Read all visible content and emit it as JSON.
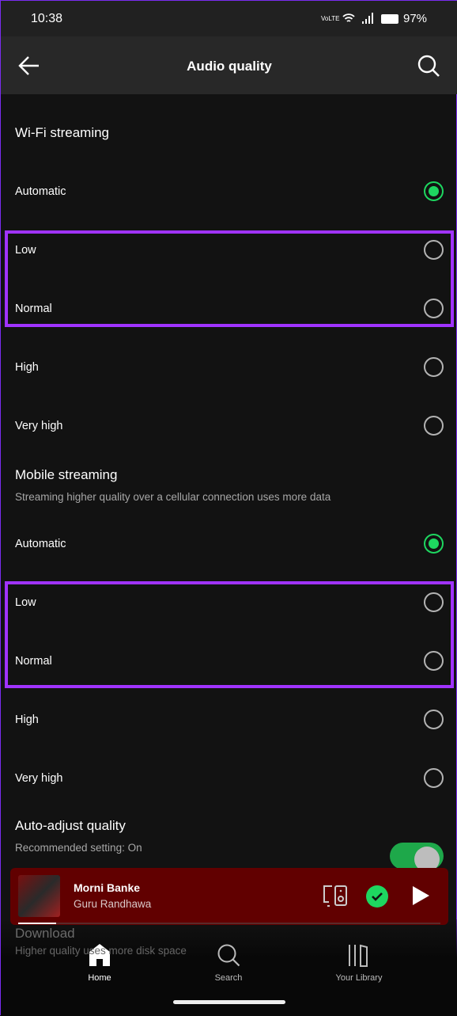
{
  "status_bar": {
    "time": "10:38",
    "network": "VoLTE",
    "battery": "97%"
  },
  "header": {
    "title": "Audio quality",
    "back_icon": "arrow-left-icon",
    "search_icon": "search-icon"
  },
  "wifi": {
    "title": "Wi-Fi streaming",
    "options": [
      {
        "label": "Automatic",
        "selected": true
      },
      {
        "label": "Low",
        "selected": false
      },
      {
        "label": "Normal",
        "selected": false
      },
      {
        "label": "High",
        "selected": false
      },
      {
        "label": "Very high",
        "selected": false
      }
    ]
  },
  "mobile": {
    "title": "Mobile streaming",
    "subtitle": "Streaming higher quality over a cellular connection uses more data",
    "options": [
      {
        "label": "Automatic",
        "selected": true
      },
      {
        "label": "Low",
        "selected": false
      },
      {
        "label": "Normal",
        "selected": false
      },
      {
        "label": "High",
        "selected": false
      },
      {
        "label": "Very high",
        "selected": false
      }
    ]
  },
  "auto_adjust": {
    "title": "Auto-adjust quality",
    "subtitle": "Recommended setting: On",
    "enabled": true
  },
  "download": {
    "title": "Download",
    "subtitle": "Higher quality uses more disk space"
  },
  "player": {
    "track": "Morni Banke",
    "artist": "Guru Randhawa",
    "progress": 0.09
  },
  "nav": {
    "items": [
      {
        "label": "Home",
        "active": true
      },
      {
        "label": "Search",
        "active": false
      },
      {
        "label": "Your Library",
        "active": false
      }
    ]
  },
  "colors": {
    "accent": "#1ed760",
    "highlight": "#a033ff",
    "player_bg": "#610000"
  }
}
